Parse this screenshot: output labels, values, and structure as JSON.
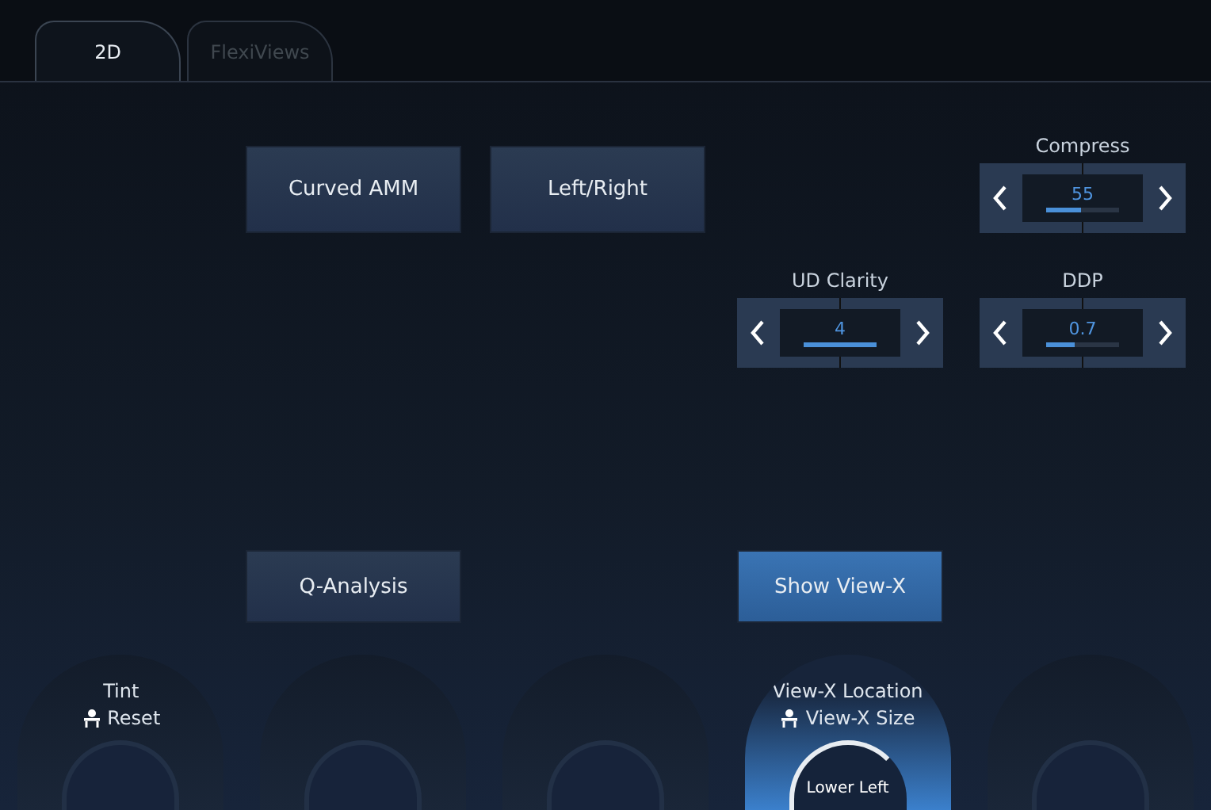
{
  "tabs": [
    {
      "label": "2D",
      "selected": true
    },
    {
      "label": "FlexiViews",
      "selected": false
    }
  ],
  "buttons_top": [
    {
      "label": "Curved AMM",
      "selected": false
    },
    {
      "label": "Left/Right",
      "selected": false
    }
  ],
  "spinners": [
    {
      "label": "Compress",
      "value": "55",
      "level": 0.48
    },
    {
      "label": "UD Clarity",
      "value": "4",
      "level": 1.0
    },
    {
      "label": "DDP",
      "value": "0.7",
      "level": 0.39
    }
  ],
  "buttons_bottom": [
    {
      "label": "Q-Analysis",
      "selected": false
    },
    {
      "label": "Show View-X",
      "selected": true
    }
  ],
  "knobs": [
    {
      "kind": "labeled",
      "label": "Tint",
      "sublabel": "Reset",
      "active": false
    },
    {
      "kind": "empty"
    },
    {
      "kind": "empty"
    },
    {
      "kind": "labeled",
      "label": "View-X Location",
      "sublabel": "View-X Size",
      "value": "Lower Left",
      "active": true
    },
    {
      "kind": "empty"
    }
  ]
}
